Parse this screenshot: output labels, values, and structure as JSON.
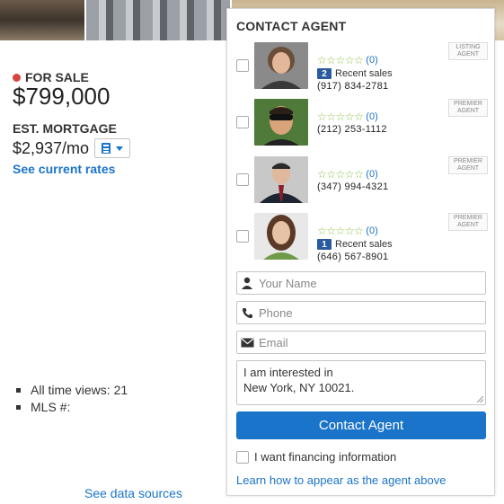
{
  "listing": {
    "status": "FOR SALE",
    "price": "$799,000",
    "mortgage_label": "EST. MORTGAGE",
    "mortgage_value": "$2,937/mo",
    "rates_link": "See current rates",
    "facts": [
      "All time views: 21",
      "MLS #:"
    ],
    "data_sources_link": "See data sources"
  },
  "colors": {
    "accent": "#1a74c9",
    "status_dot": "#d64541",
    "stars": "#8bc34a",
    "badge": "#2a5aa0"
  },
  "contact": {
    "title": "CONTACT AGENT",
    "agents": [
      {
        "stars": "☆☆☆☆☆",
        "rating": "(0)",
        "sales_count": "2",
        "sales_label": "Recent sales",
        "phone": "(917) 834-2781",
        "tag": "LISTING AGENT"
      },
      {
        "stars": "☆☆☆☆☆",
        "rating": "(0)",
        "phone": "(212) 253-1112",
        "tag": "PREMIER AGENT"
      },
      {
        "stars": "☆☆☆☆☆",
        "rating": "(0)",
        "phone": "(347) 994-4321",
        "tag": "PREMIER AGENT"
      },
      {
        "stars": "☆☆☆☆☆",
        "rating": "(0)",
        "sales_count": "1",
        "sales_label": "Recent sales",
        "phone": "(646) 567-8901",
        "tag": "PREMIER AGENT"
      }
    ],
    "name_placeholder": "Your Name",
    "phone_placeholder": "Phone",
    "email_placeholder": "Email",
    "message_line1": "I am interested in",
    "message_line2": "New York, NY 10021.",
    "submit_label": "Contact Agent",
    "financing_label": "I want financing information",
    "learn_link": "Learn how to appear as the agent above"
  },
  "icons": [
    "calculator-icon",
    "chevron-down-icon",
    "person-icon",
    "phone-icon",
    "envelope-icon"
  ]
}
